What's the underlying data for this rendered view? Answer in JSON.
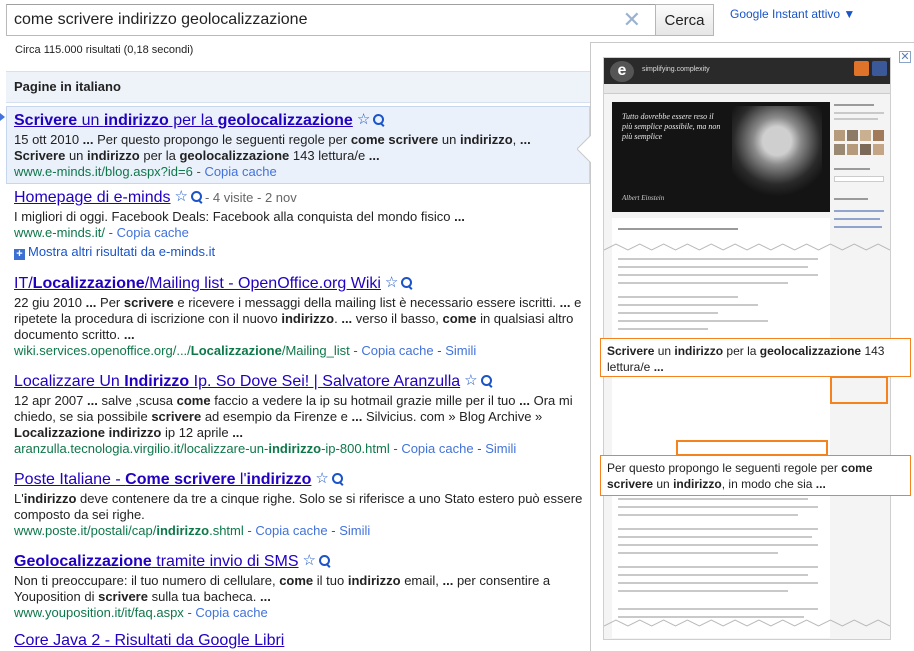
{
  "search": {
    "query": "come scrivere indirizzo geolocalizzazione",
    "button_label": "Cerca",
    "instant_label": "Google Instant attivo ▼"
  },
  "stats": "Circa 115.000 risultati (0,18 secondi)",
  "section_title": "Pagine in italiano",
  "results": [
    {
      "title_html": "<b>Scrivere</b> un <b>indirizzo</b> per la <b>geolocalizzazione</b>",
      "snippet_html": "15 ott 2010 <b>...</b> Per questo propongo le seguenti regole per <b>come scrivere</b> un <b>indirizzo</b>, <b>...</b> <b>Scrivere</b> un <b>indirizzo</b> per la <b>geolocalizzazione</b> 143 lettura/e <b>...</b>",
      "url": "www.e-minds.it/blog.aspx?id=6",
      "cache": "Copia cache"
    },
    {
      "title_html": "Homepage di e-minds",
      "visits": "- 4 visite - 2 nov",
      "snippet_html": "I migliori di oggi. Facebook Deals: Facebook alla conquista del mondo fisico <b>...</b>",
      "url": "www.e-minds.it/",
      "cache": "Copia cache"
    },
    {
      "title_html": "IT/<b>Localizzazione</b>/Mailing list - OpenOffice.org Wiki",
      "snippet_html": "22 giu 2010 <b>...</b> Per <b>scrivere</b> e ricevere i messaggi della mailing list è necessario essere iscritti. <b>...</b> e ripetete la procedura di iscrizione con il nuovo <b>indirizzo</b>. <b>...</b> verso il basso, <b>come</b> in qualsiasi altro documento scritto. <b>...</b>",
      "url_html": "wiki.services.openoffice.org/.../<b>Localizzazione</b>/Mailing_list",
      "cache": "Copia cache",
      "similar": "Simili"
    },
    {
      "title_html": "Localizzare Un <b>Indirizzo</b> Ip. So Dove Sei! | Salvatore Aranzulla",
      "snippet_html": "12 apr 2007 <b>...</b> salve ,scusa <b>come</b> faccio a vedere la ip su hotmail grazie mille per il tuo <b>...</b> Ora mi chiedo, se sia possibile <b>scrivere</b> ad esempio da Firenze e <b>...</b> Silvicius. com » Blog Archive » <b>Localizzazione indirizzo</b> ip 12 aprile <b>...</b>",
      "url_html": "aranzulla.tecnologia.virgilio.it/localizzare-un-<b>indirizzo</b>-ip-800.html",
      "cache": "Copia cache",
      "similar": "Simili"
    },
    {
      "title_html": "Poste Italiane - <b>Come scrivere</b> l'<b>indirizzo</b>",
      "snippet_html": "L'<b>indirizzo</b> deve contenere da tre a cinque righe. Solo se si riferisce a uno Stato estero può essere composto da sei righe.",
      "url_html": "www.poste.it/postali/cap/<b>indirizzo</b>.shtml",
      "cache": "Copia cache",
      "similar": "Simili"
    },
    {
      "title_html": "<b>Geolocalizzazione</b> tramite invio di SMS",
      "snippet_html": "Non ti preoccupare: il tuo numero di cellulare, <b>come</b> il tuo <b>indirizzo</b> email, <b>...</b> per consentire a Youposition di <b>scrivere</b> sulla tua bacheca. <b>...</b>",
      "url": "www.youposition.it/it/faq.aspx",
      "cache": "Copia cache"
    },
    {
      "title_html": "Core Java 2 - Risultati da Google Libri"
    }
  ],
  "more_results": "Mostra altri risultati da e-minds.it",
  "preview": {
    "tagline": "simplifying.complexity",
    "quote": "Tutto dovrebbe essere reso il più semplice possibile, ma non più semplice",
    "name": "Albert Einstein",
    "callout_1_html": "<b>Scrivere</b> un <b>indirizzo</b> per la <b>geolocalizzazione</b> 143 lettura/e <b>...</b>",
    "callout_2_html": "Per questo propongo le seguenti regole per <b>come scrivere</b> un <b>indirizzo</b>, in modo che sia <b>...</b>"
  },
  "colors": {
    "link": "#2200c1",
    "url_green": "#0e774a",
    "highlight_orange": "#f3821f",
    "section_bg": "#eef3fa"
  }
}
